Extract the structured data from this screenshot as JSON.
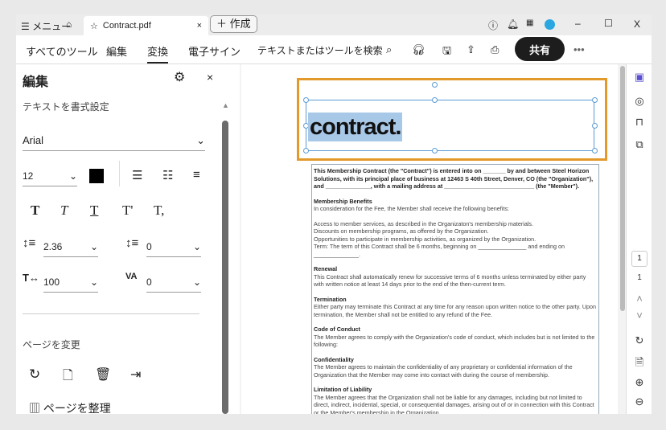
{
  "titlebar": {
    "menu": "メニュー",
    "tab_title": "Contract.pdf",
    "new_button": "作成",
    "minimize": "–",
    "maximize": "☐",
    "close": "X"
  },
  "toolbar": {
    "items": [
      "すべてのツール",
      "編集",
      "変換",
      "電子サイン"
    ],
    "active": "変換",
    "search_placeholder": "テキストまたはツールを検索",
    "share": "共有",
    "more": "•••"
  },
  "panel": {
    "title": "編集",
    "section_text": "テキストを書式設定",
    "font": "Arial",
    "size": "12",
    "line_spacing": "2.36",
    "para_spacing": "0",
    "scale": "100",
    "char_spacing": "0",
    "section_page": "ページを変更",
    "organize": "ページを整理",
    "text_color": "#000000"
  },
  "document": {
    "heading": "contract.",
    "intro": "This Membership Contract (the \"Contract\") is entered into on _______ by and between Steel Horizon Solutions, with its principal place of business at 12463 S 40th Street, Denver, CO (the \"Organization\"), and ______________, with a mailing address at ____________________________ (the \"Member\").",
    "sections": [
      {
        "title": "Membership Benefits",
        "lines": [
          "In consideration for the Fee, the Member shall receive the following benefits:"
        ]
      },
      {
        "title": "",
        "lines": [
          "Access to member services, as described in the Organizaton's membership materials.",
          "Discounts on membership programs, as offered by the Organization.",
          "Opportunities to participate in membership activities, as organized by the Organization.",
          "Term: The term of this Contract shall be 6 months, beginning on _______________ and ending on ______________."
        ]
      },
      {
        "title": "Renewal",
        "lines": [
          "This Contract shall automatically renew for successive terms of 6 months unless terminated by either party with written notice at least 14 days prior to the end of the then-current term."
        ]
      },
      {
        "title": "Termination",
        "lines": [
          "Either party may terminate this Contract at any time for any reason upon written notice to the other party. Upon termination, the Member shall not be entitled to any refund of the Fee."
        ]
      },
      {
        "title": "Code of Conduct",
        "lines": [
          "The Member agrees to comply with the Organization's code of conduct, which includes but is not limited to the following:"
        ]
      },
      {
        "title": "Confidentiality",
        "lines": [
          "The Member agrees to maintain the confidentiality of any proprietary or confidential information of the Organization that the Member may come into contact with during the course of membership."
        ]
      },
      {
        "title": "Limitation of Liability",
        "lines": [
          "The Member agrees that the Organization shall not be liable for any damages, including but not limited to direct, indirect, incidental, special, or consequential damages, arising out of or in connection with this Contract or the Member's membership in the Organization."
        ]
      }
    ]
  },
  "rail": {
    "page_input": "1",
    "page_total": "1"
  },
  "colors": {
    "accent": "#e39a2b",
    "selection": "#a8c8e8"
  }
}
